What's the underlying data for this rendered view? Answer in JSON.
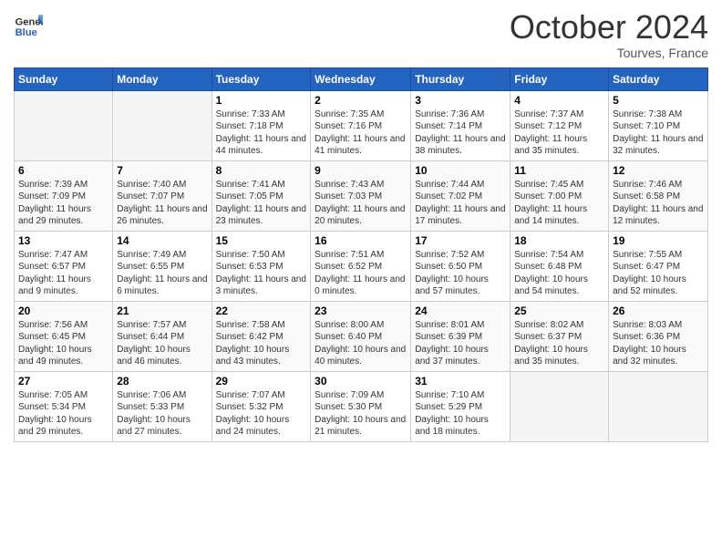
{
  "header": {
    "logo_line1": "General",
    "logo_line2": "Blue",
    "month_title": "October 2024",
    "subtitle": "Tourves, France"
  },
  "weekdays": [
    "Sunday",
    "Monday",
    "Tuesday",
    "Wednesday",
    "Thursday",
    "Friday",
    "Saturday"
  ],
  "weeks": [
    [
      {
        "day": "",
        "empty": true
      },
      {
        "day": "",
        "empty": true
      },
      {
        "day": "1",
        "sunrise": "Sunrise: 7:33 AM",
        "sunset": "Sunset: 7:18 PM",
        "daylight": "Daylight: 11 hours and 44 minutes."
      },
      {
        "day": "2",
        "sunrise": "Sunrise: 7:35 AM",
        "sunset": "Sunset: 7:16 PM",
        "daylight": "Daylight: 11 hours and 41 minutes."
      },
      {
        "day": "3",
        "sunrise": "Sunrise: 7:36 AM",
        "sunset": "Sunset: 7:14 PM",
        "daylight": "Daylight: 11 hours and 38 minutes."
      },
      {
        "day": "4",
        "sunrise": "Sunrise: 7:37 AM",
        "sunset": "Sunset: 7:12 PM",
        "daylight": "Daylight: 11 hours and 35 minutes."
      },
      {
        "day": "5",
        "sunrise": "Sunrise: 7:38 AM",
        "sunset": "Sunset: 7:10 PM",
        "daylight": "Daylight: 11 hours and 32 minutes."
      }
    ],
    [
      {
        "day": "6",
        "sunrise": "Sunrise: 7:39 AM",
        "sunset": "Sunset: 7:09 PM",
        "daylight": "Daylight: 11 hours and 29 minutes."
      },
      {
        "day": "7",
        "sunrise": "Sunrise: 7:40 AM",
        "sunset": "Sunset: 7:07 PM",
        "daylight": "Daylight: 11 hours and 26 minutes."
      },
      {
        "day": "8",
        "sunrise": "Sunrise: 7:41 AM",
        "sunset": "Sunset: 7:05 PM",
        "daylight": "Daylight: 11 hours and 23 minutes."
      },
      {
        "day": "9",
        "sunrise": "Sunrise: 7:43 AM",
        "sunset": "Sunset: 7:03 PM",
        "daylight": "Daylight: 11 hours and 20 minutes."
      },
      {
        "day": "10",
        "sunrise": "Sunrise: 7:44 AM",
        "sunset": "Sunset: 7:02 PM",
        "daylight": "Daylight: 11 hours and 17 minutes."
      },
      {
        "day": "11",
        "sunrise": "Sunrise: 7:45 AM",
        "sunset": "Sunset: 7:00 PM",
        "daylight": "Daylight: 11 hours and 14 minutes."
      },
      {
        "day": "12",
        "sunrise": "Sunrise: 7:46 AM",
        "sunset": "Sunset: 6:58 PM",
        "daylight": "Daylight: 11 hours and 12 minutes."
      }
    ],
    [
      {
        "day": "13",
        "sunrise": "Sunrise: 7:47 AM",
        "sunset": "Sunset: 6:57 PM",
        "daylight": "Daylight: 11 hours and 9 minutes."
      },
      {
        "day": "14",
        "sunrise": "Sunrise: 7:49 AM",
        "sunset": "Sunset: 6:55 PM",
        "daylight": "Daylight: 11 hours and 6 minutes."
      },
      {
        "day": "15",
        "sunrise": "Sunrise: 7:50 AM",
        "sunset": "Sunset: 6:53 PM",
        "daylight": "Daylight: 11 hours and 3 minutes."
      },
      {
        "day": "16",
        "sunrise": "Sunrise: 7:51 AM",
        "sunset": "Sunset: 6:52 PM",
        "daylight": "Daylight: 11 hours and 0 minutes."
      },
      {
        "day": "17",
        "sunrise": "Sunrise: 7:52 AM",
        "sunset": "Sunset: 6:50 PM",
        "daylight": "Daylight: 10 hours and 57 minutes."
      },
      {
        "day": "18",
        "sunrise": "Sunrise: 7:54 AM",
        "sunset": "Sunset: 6:48 PM",
        "daylight": "Daylight: 10 hours and 54 minutes."
      },
      {
        "day": "19",
        "sunrise": "Sunrise: 7:55 AM",
        "sunset": "Sunset: 6:47 PM",
        "daylight": "Daylight: 10 hours and 52 minutes."
      }
    ],
    [
      {
        "day": "20",
        "sunrise": "Sunrise: 7:56 AM",
        "sunset": "Sunset: 6:45 PM",
        "daylight": "Daylight: 10 hours and 49 minutes."
      },
      {
        "day": "21",
        "sunrise": "Sunrise: 7:57 AM",
        "sunset": "Sunset: 6:44 PM",
        "daylight": "Daylight: 10 hours and 46 minutes."
      },
      {
        "day": "22",
        "sunrise": "Sunrise: 7:58 AM",
        "sunset": "Sunset: 6:42 PM",
        "daylight": "Daylight: 10 hours and 43 minutes."
      },
      {
        "day": "23",
        "sunrise": "Sunrise: 8:00 AM",
        "sunset": "Sunset: 6:40 PM",
        "daylight": "Daylight: 10 hours and 40 minutes."
      },
      {
        "day": "24",
        "sunrise": "Sunrise: 8:01 AM",
        "sunset": "Sunset: 6:39 PM",
        "daylight": "Daylight: 10 hours and 37 minutes."
      },
      {
        "day": "25",
        "sunrise": "Sunrise: 8:02 AM",
        "sunset": "Sunset: 6:37 PM",
        "daylight": "Daylight: 10 hours and 35 minutes."
      },
      {
        "day": "26",
        "sunrise": "Sunrise: 8:03 AM",
        "sunset": "Sunset: 6:36 PM",
        "daylight": "Daylight: 10 hours and 32 minutes."
      }
    ],
    [
      {
        "day": "27",
        "sunrise": "Sunrise: 7:05 AM",
        "sunset": "Sunset: 5:34 PM",
        "daylight": "Daylight: 10 hours and 29 minutes."
      },
      {
        "day": "28",
        "sunrise": "Sunrise: 7:06 AM",
        "sunset": "Sunset: 5:33 PM",
        "daylight": "Daylight: 10 hours and 27 minutes."
      },
      {
        "day": "29",
        "sunrise": "Sunrise: 7:07 AM",
        "sunset": "Sunset: 5:32 PM",
        "daylight": "Daylight: 10 hours and 24 minutes."
      },
      {
        "day": "30",
        "sunrise": "Sunrise: 7:09 AM",
        "sunset": "Sunset: 5:30 PM",
        "daylight": "Daylight: 10 hours and 21 minutes."
      },
      {
        "day": "31",
        "sunrise": "Sunrise: 7:10 AM",
        "sunset": "Sunset: 5:29 PM",
        "daylight": "Daylight: 10 hours and 18 minutes."
      },
      {
        "day": "",
        "empty": true
      },
      {
        "day": "",
        "empty": true
      }
    ]
  ]
}
